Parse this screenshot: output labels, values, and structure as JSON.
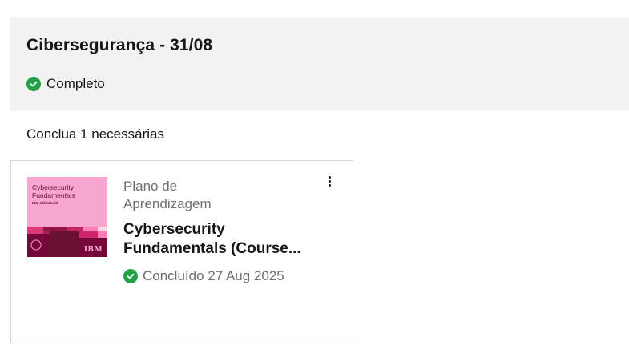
{
  "section": {
    "title": "Cibersegurança - 31/08",
    "status_label": "Completo",
    "requirement_text": "Conclua 1 necessárias"
  },
  "card": {
    "type_label": "Plano de Aprendizagem",
    "title": "Cybersecurity Fundamentals (Course...",
    "status_label": "Concluído 27 Aug 2025",
    "thumbnail": {
      "title": "Cybersecurity Fundamentals",
      "brand": "IBM SkillsBuild",
      "logo": "IBM"
    }
  },
  "colors": {
    "success": "#24a148",
    "header_bg": "#f2f2f2",
    "thumbnail_pink": "#f7a6cf",
    "thumbnail_dark": "#6b1234"
  },
  "icons": {
    "status": "checkmark-filled-icon",
    "menu": "overflow-menu-vertical-icon"
  }
}
